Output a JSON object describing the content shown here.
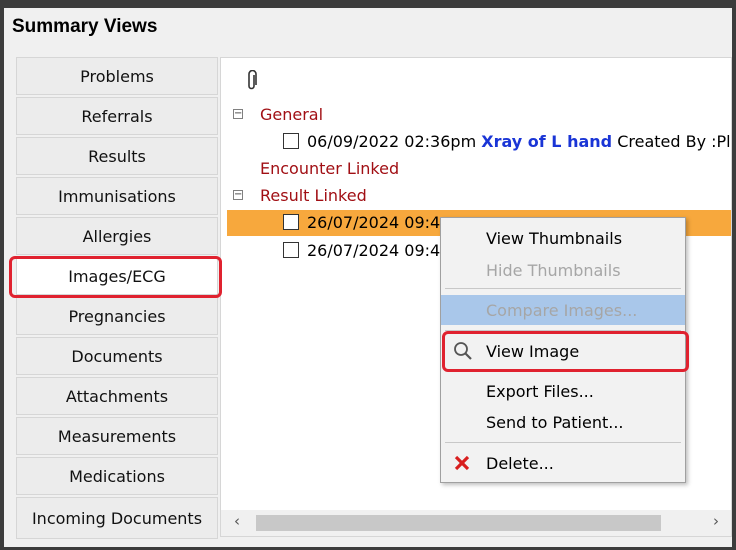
{
  "window": {
    "title": "Summary Views"
  },
  "sidebar": {
    "items": [
      {
        "label": "Problems"
      },
      {
        "label": "Referrals"
      },
      {
        "label": "Results"
      },
      {
        "label": "Immunisations"
      },
      {
        "label": "Allergies"
      },
      {
        "label": "Images/ECG"
      },
      {
        "label": "Pregnancies"
      },
      {
        "label": "Documents"
      },
      {
        "label": "Attachments"
      },
      {
        "label": "Measurements"
      },
      {
        "label": "Medications"
      },
      {
        "label": "Incoming Documents"
      }
    ],
    "selected": "Images/ECG"
  },
  "tree": {
    "attachment_icon": "paperclip-icon",
    "general": {
      "label": "General",
      "entry": {
        "datetime": "06/09/2022 02:36pm",
        "title": "Xray of L hand",
        "meta": "Created By :Pl"
      }
    },
    "encounter_linked": {
      "label": "Encounter Linked"
    },
    "result_linked": {
      "label": "Result Linked",
      "entries": [
        {
          "datetime": "26/07/2024 09:4",
          "selected": true
        },
        {
          "datetime": "26/07/2024 09:4",
          "selected": false
        }
      ]
    }
  },
  "context_menu": {
    "items": [
      {
        "label": "View Thumbnails",
        "enabled": true
      },
      {
        "label": "Hide Thumbnails",
        "enabled": false
      },
      {
        "label": "Compare Images...",
        "enabled": false
      },
      {
        "label": "View Image",
        "enabled": true,
        "icon": "magnifier-icon"
      },
      {
        "label": "Export Files...",
        "enabled": true
      },
      {
        "label": "Send to Patient...",
        "enabled": true
      },
      {
        "label": "Delete...",
        "enabled": true,
        "icon": "delete-x-icon"
      }
    ]
  },
  "scrollbar": {
    "left_arrow": "‹",
    "right_arrow": "›"
  },
  "colors": {
    "group_text": "#a10f14",
    "link_text": "#1a35d6",
    "selection_row": "#f7a83d",
    "menu_hover": "#a9c7ea",
    "highlight_box": "#e0222f",
    "delete_icon": "#d81e1e"
  }
}
